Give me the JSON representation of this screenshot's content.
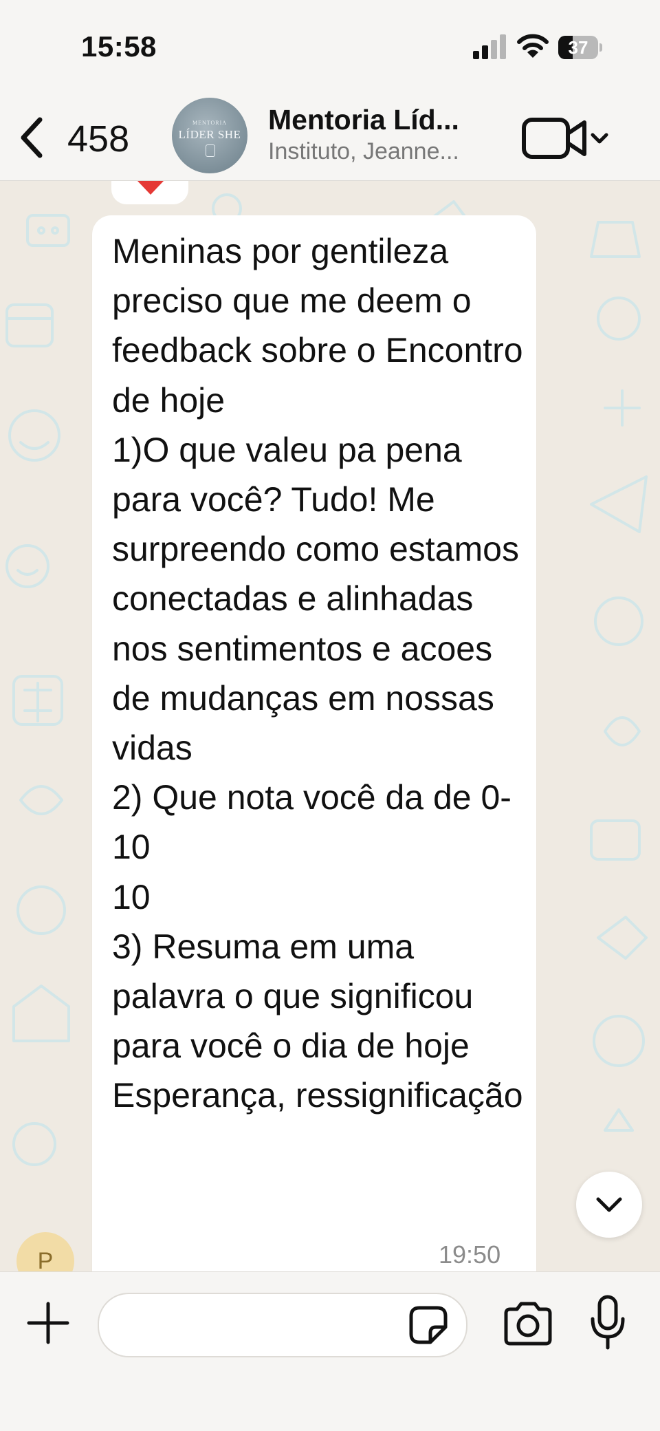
{
  "status_bar": {
    "time": "15:58",
    "battery_level": "37",
    "battery_fraction": 0.37
  },
  "header": {
    "back_count": "458",
    "group_name": "Mentoria Líd...",
    "group_members": "Instituto, Jeanne...",
    "avatar_top_text": "MENTORIA",
    "avatar_main_text": "LÍDER SHE",
    "icons": {
      "back": "chevron-left-icon",
      "video": "video-camera-icon",
      "dropdown": "chevron-down-icon"
    }
  },
  "chat": {
    "message": {
      "text": "Meninas por gentileza preciso que me deem o feedback sobre o Encontro de hoje\n1)O que valeu pa pena para você? Tudo! Me surpreendo como estamos conectadas e alinhadas nos sentimentos e acoes de mudanças em nossas vidas\n2) Que nota você da de 0-10\n10\n3) Resuma em uma palavra o que significou para você o dia de hoje\nEsperança, ressignificação",
      "time": "19:50"
    },
    "sender_initial": "P",
    "previous_reaction": "heart",
    "icons": {
      "scroll_down": "chevron-down-icon"
    }
  },
  "input_bar": {
    "message_placeholder": "",
    "message_value": "",
    "icons": {
      "attach": "plus-icon",
      "sticker": "sticker-icon",
      "camera": "camera-icon",
      "mic": "microphone-icon"
    }
  },
  "colors": {
    "chat_background": "#efeae2",
    "bubble": "#ffffff",
    "bar_background": "#f6f5f3",
    "doodle": "#cfe4e6",
    "sender_avatar": "#f2dca6",
    "heart": "#e53935"
  }
}
